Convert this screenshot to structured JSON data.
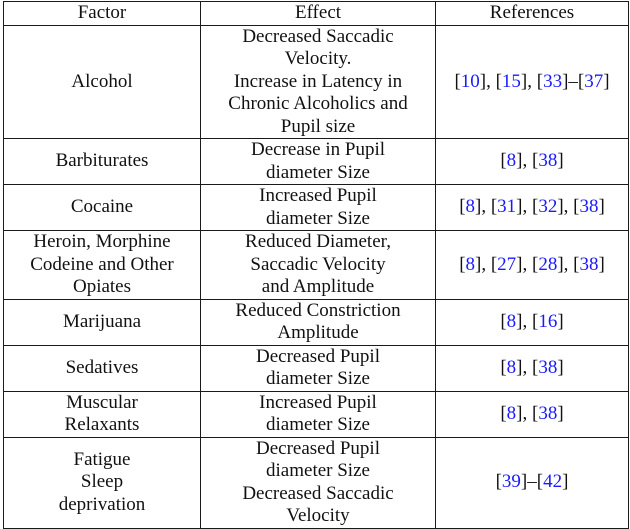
{
  "table": {
    "headers": [
      "Factor",
      "Effect",
      "References"
    ],
    "rows": [
      {
        "factor": [
          "Alcohol"
        ],
        "effect": [
          "Decreased Saccadic",
          "Velocity.",
          "Increase in Latency in",
          "Chronic Alcoholics and",
          "Pupil size"
        ],
        "references": [
          {
            "type": "cite",
            "text": "10"
          },
          {
            "type": "sep",
            "text": ", "
          },
          {
            "type": "cite",
            "text": "15"
          },
          {
            "type": "sep",
            "text": ", "
          },
          {
            "type": "cite",
            "text": "33"
          },
          {
            "type": "sep",
            "text": "–"
          },
          {
            "type": "cite",
            "text": "37"
          }
        ]
      },
      {
        "factor": [
          "Barbiturates"
        ],
        "effect": [
          "Decrease in Pupil",
          "diameter Size"
        ],
        "references": [
          {
            "type": "cite",
            "text": "8"
          },
          {
            "type": "sep",
            "text": ", "
          },
          {
            "type": "cite",
            "text": "38"
          }
        ]
      },
      {
        "factor": [
          "Cocaine"
        ],
        "effect": [
          "Increased Pupil",
          "diameter Size"
        ],
        "references": [
          {
            "type": "cite",
            "text": "8"
          },
          {
            "type": "sep",
            "text": ", "
          },
          {
            "type": "cite",
            "text": "31"
          },
          {
            "type": "sep",
            "text": ", "
          },
          {
            "type": "cite",
            "text": "32"
          },
          {
            "type": "sep",
            "text": ", "
          },
          {
            "type": "cite",
            "text": "38"
          }
        ]
      },
      {
        "factor": [
          "Heroin, Morphine",
          "Codeine and Other",
          "Opiates"
        ],
        "effect": [
          "Reduced Diameter,",
          "Saccadic Velocity",
          "and Amplitude"
        ],
        "references": [
          {
            "type": "cite",
            "text": "8"
          },
          {
            "type": "sep",
            "text": ", "
          },
          {
            "type": "cite",
            "text": "27"
          },
          {
            "type": "sep",
            "text": ", "
          },
          {
            "type": "cite",
            "text": "28"
          },
          {
            "type": "sep",
            "text": ", "
          },
          {
            "type": "cite",
            "text": "38"
          }
        ]
      },
      {
        "factor": [
          "Marijuana"
        ],
        "effect": [
          "Reduced Constriction",
          "Amplitude"
        ],
        "references": [
          {
            "type": "cite",
            "text": "8"
          },
          {
            "type": "sep",
            "text": ", "
          },
          {
            "type": "cite",
            "text": "16"
          }
        ]
      },
      {
        "factor": [
          "Sedatives"
        ],
        "effect": [
          "Decreased Pupil",
          "diameter Size"
        ],
        "references": [
          {
            "type": "cite",
            "text": "8"
          },
          {
            "type": "sep",
            "text": ", "
          },
          {
            "type": "cite",
            "text": "38"
          }
        ]
      },
      {
        "factor": [
          "Muscular",
          "Relaxants"
        ],
        "effect": [
          "Increased Pupil",
          "diameter Size"
        ],
        "references": [
          {
            "type": "cite",
            "text": "8"
          },
          {
            "type": "sep",
            "text": ", "
          },
          {
            "type": "cite",
            "text": "38"
          }
        ]
      },
      {
        "factor": [
          "Fatigue",
          "Sleep",
          "deprivation"
        ],
        "effect": [
          "Decreased Pupil",
          "diameter Size",
          "Decreased Saccadic",
          "Velocity"
        ],
        "references": [
          {
            "type": "cite",
            "text": "39"
          },
          {
            "type": "sep",
            "text": "–"
          },
          {
            "type": "cite",
            "text": "42"
          }
        ]
      }
    ]
  },
  "colors": {
    "citation": "#1a1aff",
    "text": "#111111",
    "border": "#1a1a1a"
  }
}
